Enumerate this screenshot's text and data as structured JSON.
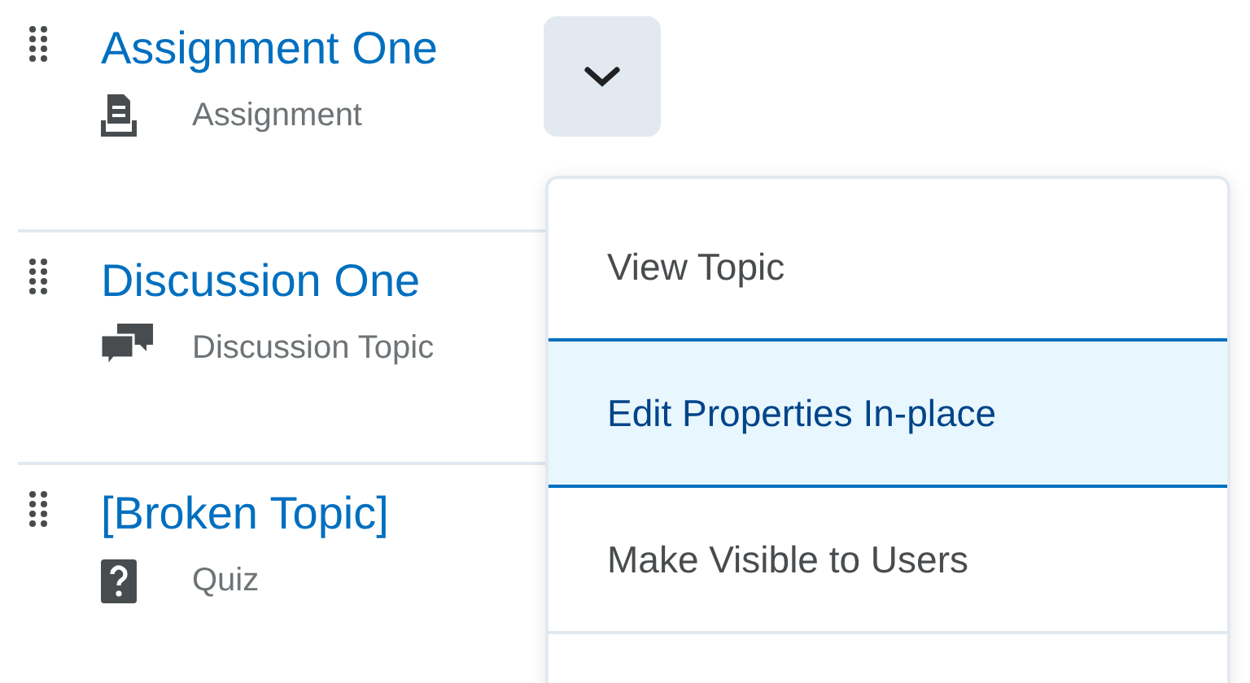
{
  "topics": [
    {
      "title": "Assignment One",
      "kind": "assignment",
      "type_label": "Assignment",
      "menu_open": true
    },
    {
      "title": "Discussion One",
      "kind": "discussion",
      "type_label": "Discussion Topic",
      "menu_open": false
    },
    {
      "title": "[Broken Topic]",
      "kind": "quiz",
      "type_label": "Quiz",
      "menu_open": false
    }
  ],
  "menu": {
    "items": [
      {
        "label": "View Topic",
        "selected": false
      },
      {
        "label": "Edit Properties In-place",
        "selected": true
      },
      {
        "label": "Make Visible to Users",
        "selected": false
      }
    ]
  }
}
